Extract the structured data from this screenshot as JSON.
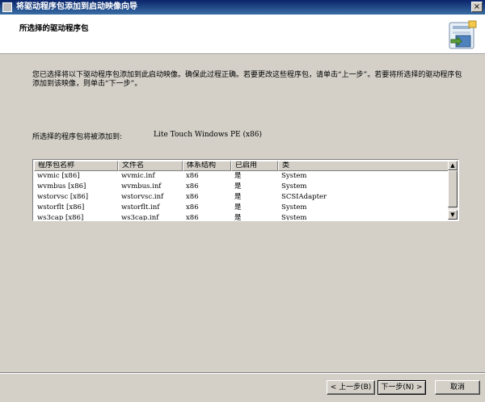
{
  "window": {
    "title": "将驱动程序包添加到启动映像向导",
    "close_glyph": "×"
  },
  "header": {
    "title": "所选择的驱动程序包",
    "icon": "wizard-package-icon"
  },
  "intro_text": "您已选择将以下驱动程序包添加到此启动映像。确保此过程正确。若要更改这些程序包，请单击“上一步”。若要将所选择的驱动程序包添加到该映像，则单击“下一步”。",
  "target": {
    "label": "所选择的程序包将被添加到:",
    "value": "Lite Touch Windows PE (x86)"
  },
  "table": {
    "columns": [
      "程序包名称",
      "文件名",
      "体系结构",
      "已启用",
      "类"
    ],
    "rows": [
      [
        "wvmic [x86]",
        "wvmic.inf",
        "x86",
        "是",
        "System"
      ],
      [
        "wvmbus [x86]",
        "wvmbus.inf",
        "x86",
        "是",
        "System"
      ],
      [
        "wstorvsc [x86]",
        "wstorvsc.inf",
        "x86",
        "是",
        "SCSIAdapter"
      ],
      [
        "wstorflt [x86]",
        "wstorflt.inf",
        "x86",
        "是",
        "System"
      ],
      [
        "ws3cap [x86]",
        "ws3cap.inf",
        "x86",
        "是",
        "System"
      ]
    ]
  },
  "buttons": {
    "back": "< 上一步(B)",
    "next": "下一步(N) >",
    "cancel": "取消"
  },
  "colors": {
    "titlebar": "#0a246a",
    "dialog_bg": "#d4d0c8"
  }
}
